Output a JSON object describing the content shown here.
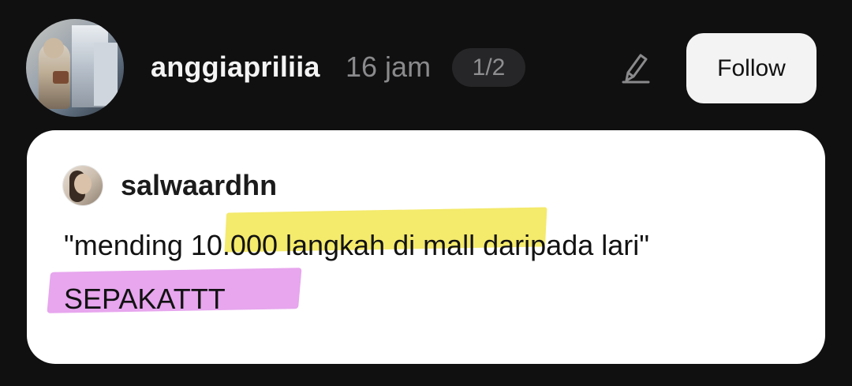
{
  "header": {
    "username": "anggiapriliia",
    "timestamp": "16 jam",
    "page_indicator": "1/2",
    "follow_label": "Follow"
  },
  "card": {
    "quoted_username": "salwaardhn",
    "quote_text": "\"mending 10.000 langkah di mall daripada lari\"",
    "reply_text": "SEPAKATTT",
    "highlight_colors": {
      "yellow": "#f4ea6c",
      "pink": "#e7a6ee"
    }
  },
  "icons": {
    "draw": "pen-draw-icon"
  },
  "colors": {
    "background": "#101011",
    "card": "#ffffff",
    "follow_button": "#f3f3f3"
  }
}
